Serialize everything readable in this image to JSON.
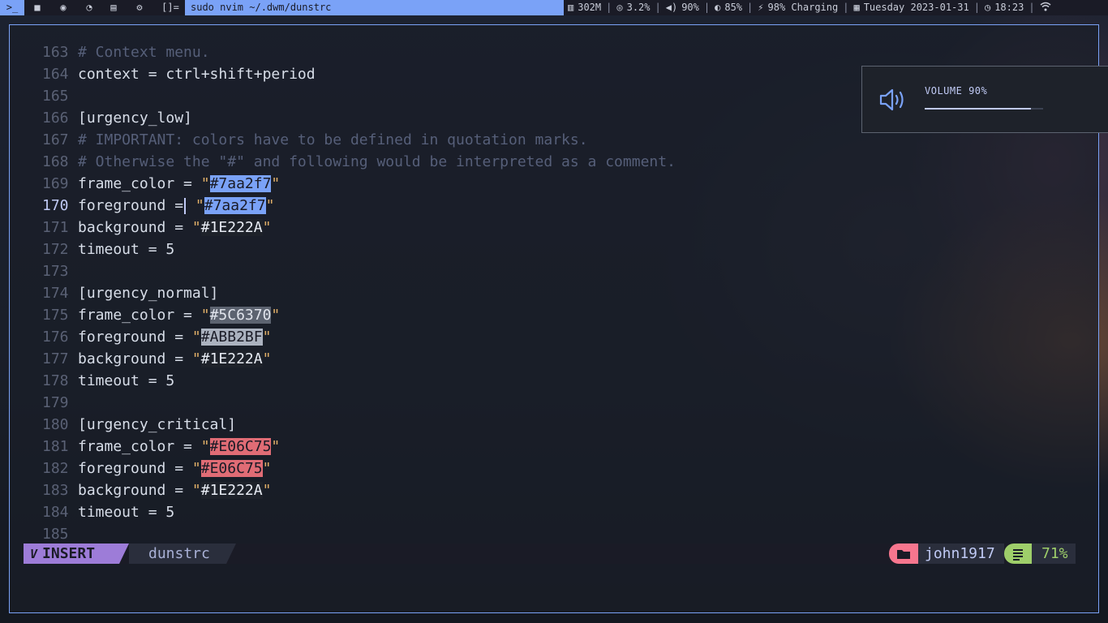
{
  "topbar": {
    "tags": [
      {
        "icon": "terminal-icon",
        "glyph": ">_",
        "active": true
      },
      {
        "icon": "video-icon",
        "glyph": "■",
        "active": false
      },
      {
        "icon": "discord-icon",
        "glyph": "◉",
        "active": false
      },
      {
        "icon": "firefox-icon",
        "glyph": "◔",
        "active": false
      },
      {
        "icon": "notes-icon",
        "glyph": "▤",
        "active": false
      },
      {
        "icon": "gear-icon",
        "glyph": "⚙",
        "active": false
      }
    ],
    "layout_symbol": "[]=",
    "window_title": "sudo nvim ~/.dwm/dunstrc",
    "status": {
      "memory": "302M",
      "cpu": "3.2%",
      "volume": "90%",
      "brightness": "85%",
      "battery": "98% Charging",
      "date": "Tuesday 2023-01-31",
      "time": "18:23"
    }
  },
  "editor": {
    "lines": [
      {
        "n": "163",
        "text": "# Context menu.",
        "type": "comment"
      },
      {
        "n": "164",
        "text": "context = ctrl+shift+period",
        "type": "code"
      },
      {
        "n": "165",
        "text": "",
        "type": "code"
      },
      {
        "n": "166",
        "text": "[urgency_low]",
        "type": "code"
      },
      {
        "n": "167",
        "text": "# IMPORTANT: colors have to be defined in quotation marks.",
        "type": "comment"
      },
      {
        "n": "168",
        "text": "# Otherwise the \"#\" and following would be interpreted as a comment.",
        "type": "comment"
      },
      {
        "n": "169",
        "key": "frame_color = ",
        "value": "#7aa2f7",
        "hl": "#7aa2f7",
        "type": "color"
      },
      {
        "n": "170",
        "key": "foreground =",
        "cursor": true,
        "value": "#7aa2f7",
        "hl": "#7aa2f7",
        "type": "color",
        "current": true
      },
      {
        "n": "171",
        "key": "background = ",
        "value": "#1E222A",
        "hl": "#1E222A",
        "type": "color"
      },
      {
        "n": "172",
        "text": "timeout = 5",
        "type": "code"
      },
      {
        "n": "173",
        "text": "",
        "type": "code"
      },
      {
        "n": "174",
        "text": "[urgency_normal]",
        "type": "code"
      },
      {
        "n": "175",
        "key": "frame_color = ",
        "value": "#5C6370",
        "hl": "#5C6370",
        "type": "color"
      },
      {
        "n": "176",
        "key": "foreground = ",
        "value": "#ABB2BF",
        "hl": "#ABB2BF",
        "type": "color"
      },
      {
        "n": "177",
        "key": "background = ",
        "value": "#1E222A",
        "hl": "#1E222A",
        "type": "color"
      },
      {
        "n": "178",
        "text": "timeout = 5",
        "type": "code"
      },
      {
        "n": "179",
        "text": "",
        "type": "code"
      },
      {
        "n": "180",
        "text": "[urgency_critical]",
        "type": "code"
      },
      {
        "n": "181",
        "key": "frame_color = ",
        "value": "#E06C75",
        "hl": "#E06C75",
        "type": "color"
      },
      {
        "n": "182",
        "key": "foreground = ",
        "value": "#E06C75",
        "hl": "#E06C75",
        "type": "color"
      },
      {
        "n": "183",
        "key": "background = ",
        "value": "#1E222A",
        "hl": "#1E222A",
        "type": "color"
      },
      {
        "n": "184",
        "text": "timeout = 5",
        "type": "code"
      },
      {
        "n": "185",
        "text": "",
        "type": "code"
      }
    ],
    "current_line": "170"
  },
  "statusline": {
    "mode_icon": "vim-icon",
    "mode_glyph": "V",
    "mode": "INSERT",
    "file": "dunstrc",
    "dir_icon": "folder-icon",
    "dir": "john1917",
    "pct_icon": "document-lines-icon",
    "percent": "71%"
  },
  "volume_popup": {
    "label": "VOLUME 90%",
    "level": 0.9,
    "icon": "speaker-icon"
  },
  "colors": {
    "accent": "#7aa2f7",
    "mode_bg": "#9d7cd8",
    "dir_bg": "#f7768e",
    "pct_bg": "#9ece6a",
    "string_quote": "#e0af68"
  }
}
